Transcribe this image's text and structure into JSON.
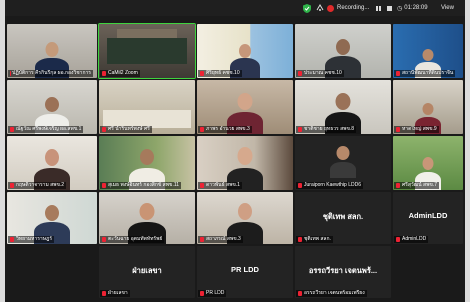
{
  "topbar": {
    "recording_label": "Recording...",
    "timer": "01:28:09",
    "view_label": "View"
  },
  "colors": {
    "record_red": "#e02a2a",
    "active_speaker": "#3ed33e",
    "shield_green": "#2fb34a"
  },
  "tiles": [
    {
      "name": "ปฏิบัติการ คีรกินรีกุล ผอ.กองวิชาการ",
      "big": ""
    },
    {
      "name": "CaMil2 Zoom",
      "big": ""
    },
    {
      "name": "ศิริยุทธ์ คชช.10",
      "big": ""
    },
    {
      "name": "ประมาณ คชช.10",
      "big": ""
    },
    {
      "name": "สถานีพัฒนาที่ดินปราจีน",
      "big": ""
    },
    {
      "name": "ณัฐวัณ ศรีพงษ์เจริญ ผอ.สพข.1",
      "big": ""
    },
    {
      "name": "ศรี นำรินทร์พงษ์ ศรี",
      "big": ""
    },
    {
      "name": "ภาพร อำนวย สพข.3",
      "big": ""
    },
    {
      "name": "ชาติชาย ยุทธวร สพข.8",
      "big": ""
    },
    {
      "name": "หาดใหญ่ สพข.9",
      "big": ""
    },
    {
      "name": "กฤษดิ์วาจาราม สพข.2",
      "big": ""
    },
    {
      "name": "สุเมธ พงษ์อินทร์ กองสิกข์ สพข.11",
      "big": ""
    },
    {
      "name": "ดาวพันธ์ สพข.1",
      "big": ""
    },
    {
      "name": "Juraiporn Kaewthip LDD6",
      "big": ""
    },
    {
      "name": "ศรีสุวัฒน์ สพข.7",
      "big": ""
    },
    {
      "name": "วิทยามหาราษฎร์",
      "big": ""
    },
    {
      "name": "ตะวันฉาย อุตมทัพท์ทรัพย์",
      "big": ""
    },
    {
      "name": "สถาภรณ์ สพข.3",
      "big": ""
    },
    {
      "name": "ชุติเทพ สลก.",
      "big": "ชุติเทพ สลก."
    },
    {
      "name": "AdminLDD",
      "big": "AdminLDD"
    },
    {
      "name": "ฝ่ายเลขา",
      "big": "ฝ่ายเลขา"
    },
    {
      "name": "PR LDD",
      "big": "PR LDD"
    },
    {
      "name": "อรรถวีรยา เจตนพร้อมเพรียง",
      "big": "อรรถวีรยา เจตนพร้..."
    }
  ]
}
